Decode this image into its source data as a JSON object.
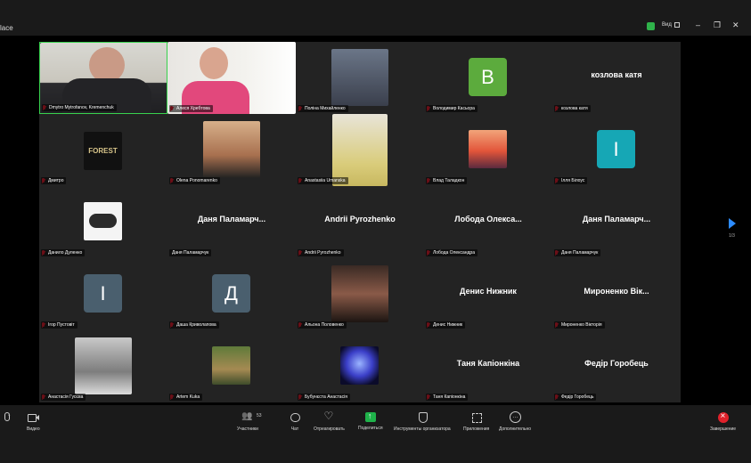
{
  "window": {
    "title": "lace",
    "view_label": "Вид",
    "minimize": "–",
    "maximize": "❐",
    "close": "✕"
  },
  "gallery": {
    "page_indicator": "1/3",
    "tiles": [
      {
        "label": "Dmytro Mytrofanov, Kremenchuk",
        "kind": "video",
        "active": true
      },
      {
        "label": "Алеся Хребтова",
        "kind": "video"
      },
      {
        "label": "Поліна Михайленко",
        "kind": "photo"
      },
      {
        "label": "Володимир Касьора",
        "kind": "initial",
        "initial": "В",
        "color": "#5cab3d"
      },
      {
        "label": "козлова катя",
        "kind": "text",
        "big": "козлова катя"
      },
      {
        "label": "Дмитро",
        "kind": "photo"
      },
      {
        "label": "Olena Ponomarenko",
        "kind": "photo"
      },
      {
        "label": "Anastasiia Umanska",
        "kind": "photo"
      },
      {
        "label": "Влад Таладкон",
        "kind": "photo"
      },
      {
        "label": "Ілля Білоус",
        "kind": "initial",
        "initial": "І",
        "color": "#16a7b5"
      },
      {
        "label": "Данило Дуленко",
        "kind": "photo"
      },
      {
        "label": "Даня Паламарчук",
        "kind": "text",
        "big": "Даня Паламарч..."
      },
      {
        "label": "Andrii Pyrozhenko",
        "kind": "text",
        "big": "Andrii Pyrozhenko"
      },
      {
        "label": "Лобода Олександра",
        "kind": "text",
        "big": "Лобода Олекса..."
      },
      {
        "label": "Даня Паламарчук",
        "kind": "text",
        "big": "Даня Паламарч..."
      },
      {
        "label": "Ігор Пустовіт",
        "kind": "initial",
        "initial": "І",
        "color": "#4a5f6e"
      },
      {
        "label": "Даша Криволапова",
        "kind": "initial",
        "initial": "Д",
        "color": "#4a5f6e"
      },
      {
        "label": "Альона Половенко",
        "kind": "photo"
      },
      {
        "label": "Денис Нижник",
        "kind": "text",
        "big": "Денис Нижник"
      },
      {
        "label": "Мироненко Вікторія",
        "kind": "text",
        "big": "Мироненко Вік..."
      },
      {
        "label": "Анастасія Гусєва",
        "kind": "photo"
      },
      {
        "label": "Artem Kuka",
        "kind": "photo"
      },
      {
        "label": "Бубунєста Анастасія",
        "kind": "photo"
      },
      {
        "label": "Таня Капіонкіна",
        "kind": "text",
        "big": "Таня Капіонкіна"
      },
      {
        "label": "Федір Горобець",
        "kind": "text",
        "big": "Федір Горобець"
      }
    ]
  },
  "toolbar": {
    "audio_label": "^",
    "video_label": "Видео",
    "participants_label": "Участники",
    "participants_count": "53",
    "chat_label": "Чат",
    "react_label": "Отреагировать",
    "share_label": "Поделиться",
    "host_tools_label": "Инструменты организатора",
    "apps_label": "Приложения",
    "more_label": "Дополнительно",
    "end_label": "Завершение"
  }
}
